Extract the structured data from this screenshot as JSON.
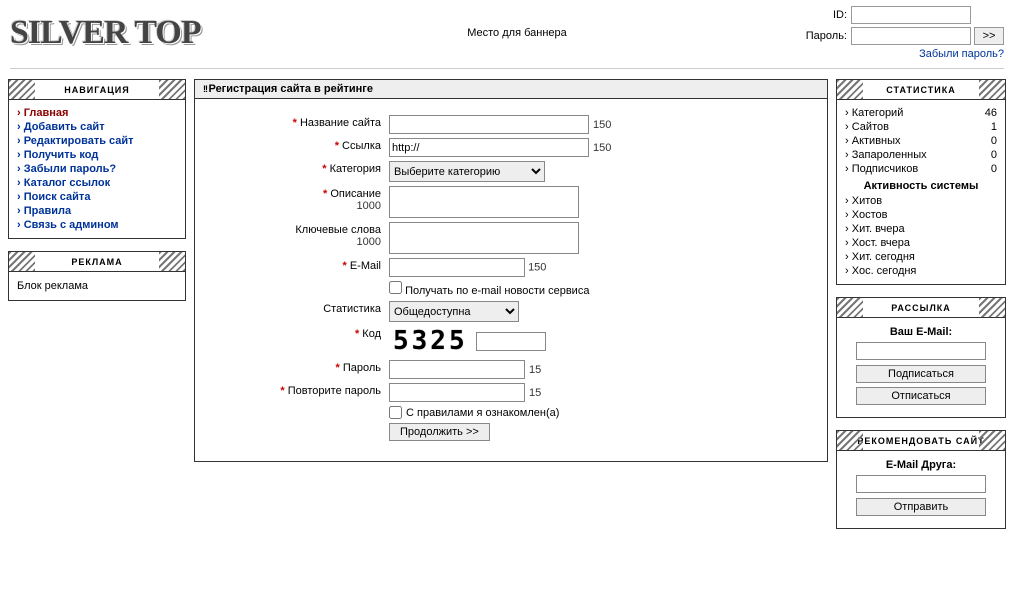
{
  "header": {
    "logo": "SILVER TOP",
    "banner_text": "Место для баннера",
    "login": {
      "id_label": "ID:",
      "pass_label": "Пароль:",
      "go": ">>",
      "forgot": "Забыли пароль?"
    }
  },
  "nav": {
    "title": "НАВИГАЦИЯ",
    "items": [
      "Главная",
      "Добавить сайт",
      "Редактировать сайт",
      "Получить код",
      "Забыли пароль?",
      "Каталог ссылок",
      "Поиск сайта",
      "Правила",
      "Связь с админом"
    ]
  },
  "ad": {
    "title": "РЕКЛАМА",
    "text": "Блок реклама"
  },
  "form": {
    "title": "Регистрация сайта в рейтинге",
    "name_label": "Название сайта",
    "name_limit": "150",
    "link_label": "Ссылка",
    "link_value": "http://",
    "link_limit": "150",
    "cat_label": "Категория",
    "cat_selected": "Выберите категорию",
    "desc_label": "Описание",
    "desc_limit": "1000",
    "kw_label": "Ключевые слова",
    "kw_limit": "1000",
    "email_label": "E-Mail",
    "email_limit": "150",
    "email_news": "Получать по e-mail новости сервиса",
    "stats_label": "Статистика",
    "stats_selected": "Общедоступна",
    "code_label": "Код",
    "code_value": "5325",
    "pass_label": "Пароль",
    "pass_limit": "15",
    "pass2_label": "Повторите пароль",
    "pass2_limit": "15",
    "rules_check": "С правилами я ознакомлен(а)",
    "submit": "Продолжить >>"
  },
  "stats": {
    "title": "СТАТИСТИКА",
    "rows": [
      {
        "k": "Категорий",
        "v": "46"
      },
      {
        "k": "Сайтов",
        "v": "1"
      },
      {
        "k": "Активных",
        "v": "0"
      },
      {
        "k": "Запароленных",
        "v": "0"
      },
      {
        "k": "Подписчиков",
        "v": "0"
      }
    ],
    "activity_title": "Активность системы",
    "activity": [
      "Хитов",
      "Хостов",
      "Хит. вчера",
      "Хост. вчера",
      "Хит. сегодня",
      "Хос. сегодня"
    ]
  },
  "subscribe": {
    "title": "РАССЫЛКА",
    "label": "Ваш E-Mail:",
    "sub": "Подписаться",
    "unsub": "Отписаться"
  },
  "recommend": {
    "title": "РЕКОМЕНДОВАТЬ САЙТ",
    "label": "E-Mail Друга:",
    "send": "Отправить"
  }
}
